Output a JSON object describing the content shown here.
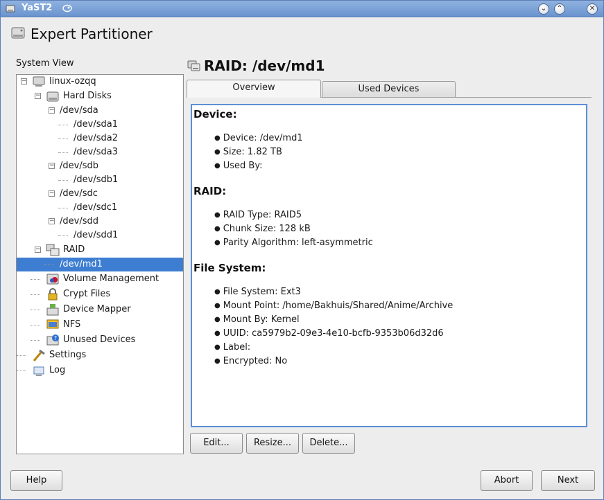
{
  "window": {
    "title": "YaST2",
    "minimize_glyph": "⌄",
    "maximize_glyph": "⌃",
    "close_glyph": "✕"
  },
  "header": {
    "title": "Expert Partitioner",
    "icon": "harddisk-icon"
  },
  "system_view": {
    "label": "System View",
    "items": [
      {
        "label": "linux-ozqq",
        "icon": "computer-icon",
        "expander": "−"
      },
      {
        "label": "Hard Disks",
        "icon": "harddisk-icon",
        "expander": "−"
      },
      {
        "label": "/dev/sda",
        "expander": "−"
      },
      {
        "label": "/dev/sda1"
      },
      {
        "label": "/dev/sda2"
      },
      {
        "label": "/dev/sda3"
      },
      {
        "label": "/dev/sdb",
        "expander": "−"
      },
      {
        "label": "/dev/sdb1"
      },
      {
        "label": "/dev/sdc",
        "expander": "−"
      },
      {
        "label": "/dev/sdc1"
      },
      {
        "label": "/dev/sdd",
        "expander": "−"
      },
      {
        "label": "/dev/sdd1"
      },
      {
        "label": "RAID",
        "icon": "raid-icon",
        "expander": "−"
      },
      {
        "label": "/dev/md1",
        "selected": true
      },
      {
        "label": "Volume Management",
        "icon": "volume-management-icon"
      },
      {
        "label": "Crypt Files",
        "icon": "lock-icon"
      },
      {
        "label": "Device Mapper",
        "icon": "device-mapper-icon"
      },
      {
        "label": "NFS",
        "icon": "nfs-icon"
      },
      {
        "label": "Unused Devices",
        "icon": "unused-devices-icon"
      },
      {
        "label": "Settings",
        "icon": "tools-icon"
      },
      {
        "label": "Log",
        "icon": "log-icon"
      }
    ]
  },
  "device": {
    "title": "RAID: /dev/md1",
    "icon": "raid-icon",
    "tabs": [
      {
        "label": "Overview",
        "active": true
      },
      {
        "label": "Used Devices",
        "active": false
      }
    ],
    "sections": [
      {
        "heading": "Device:",
        "items": [
          "Device: /dev/md1",
          "Size: 1.82 TB",
          "Used By:"
        ]
      },
      {
        "heading": "RAID:",
        "items": [
          "RAID Type: RAID5",
          "Chunk Size: 128 kB",
          "Parity Algorithm: left-asymmetric"
        ]
      },
      {
        "heading": "File System:",
        "items": [
          "File System: Ext3",
          "Mount Point: /home/Bakhuis/Shared/Anime/Archive",
          "Mount By: Kernel",
          "UUID: ca5979b2-09e3-4e10-bcfb-9353b06d32d6",
          "Label:",
          "Encrypted: No"
        ]
      }
    ]
  },
  "actions": {
    "edit": "Edit...",
    "resize": "Resize...",
    "delete": "Delete..."
  },
  "footer": {
    "help": "Help",
    "abort": "Abort",
    "next": "Next"
  },
  "colors": {
    "selection": "#3d7ed2",
    "titlebar": "#6a93cf",
    "panel_border": "#5b8fd6"
  }
}
